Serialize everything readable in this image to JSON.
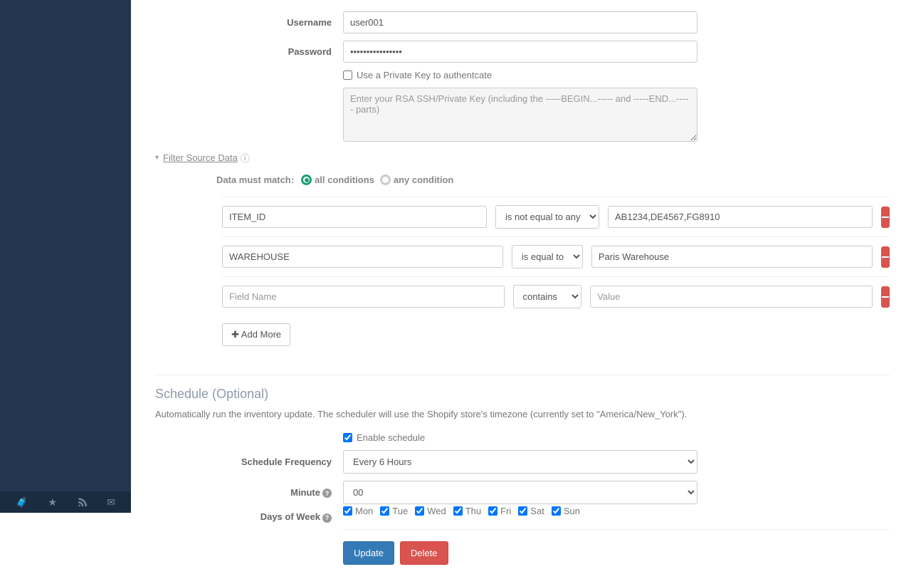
{
  "credentials": {
    "username_label": "Username",
    "username_value": "user001",
    "password_label": "Password",
    "password_value": "••••••••••••••••",
    "private_key_checkbox": "Use a Private Key to authentcate",
    "private_key_placeholder": "Enter your RSA SSH/Private Key (including the -----BEGIN...----- and -----END...----- parts)"
  },
  "filter": {
    "header": "Filter Source Data",
    "match_label": "Data must match:",
    "all_label": "all conditions",
    "any_label": "any condition",
    "field_placeholder": "Field Name",
    "value_placeholder": "Value",
    "rows": [
      {
        "field": "ITEM_ID",
        "op": "is not equal to any",
        "value": "AB1234,DE4567,FG8910"
      },
      {
        "field": "WAREHOUSE",
        "op": "is equal to",
        "value": "Paris Warehouse"
      },
      {
        "field": "",
        "op": "contains",
        "value": ""
      }
    ],
    "add_more": "Add More"
  },
  "schedule": {
    "title": "Schedule (Optional)",
    "desc": "Automatically run the inventory update. The scheduler will use the Shopify store's timezone (currently set to \"America/New_York\").",
    "enable_label": "Enable schedule",
    "frequency_label": "Schedule Frequency",
    "frequency_value": "Every 6 Hours",
    "minute_label": "Minute",
    "minute_value": "00",
    "days_label": "Days of Week",
    "days": [
      "Mon",
      "Tue",
      "Wed",
      "Thu",
      "Fri",
      "Sat",
      "Sun"
    ]
  },
  "actions": {
    "update": "Update",
    "delete": "Delete"
  }
}
